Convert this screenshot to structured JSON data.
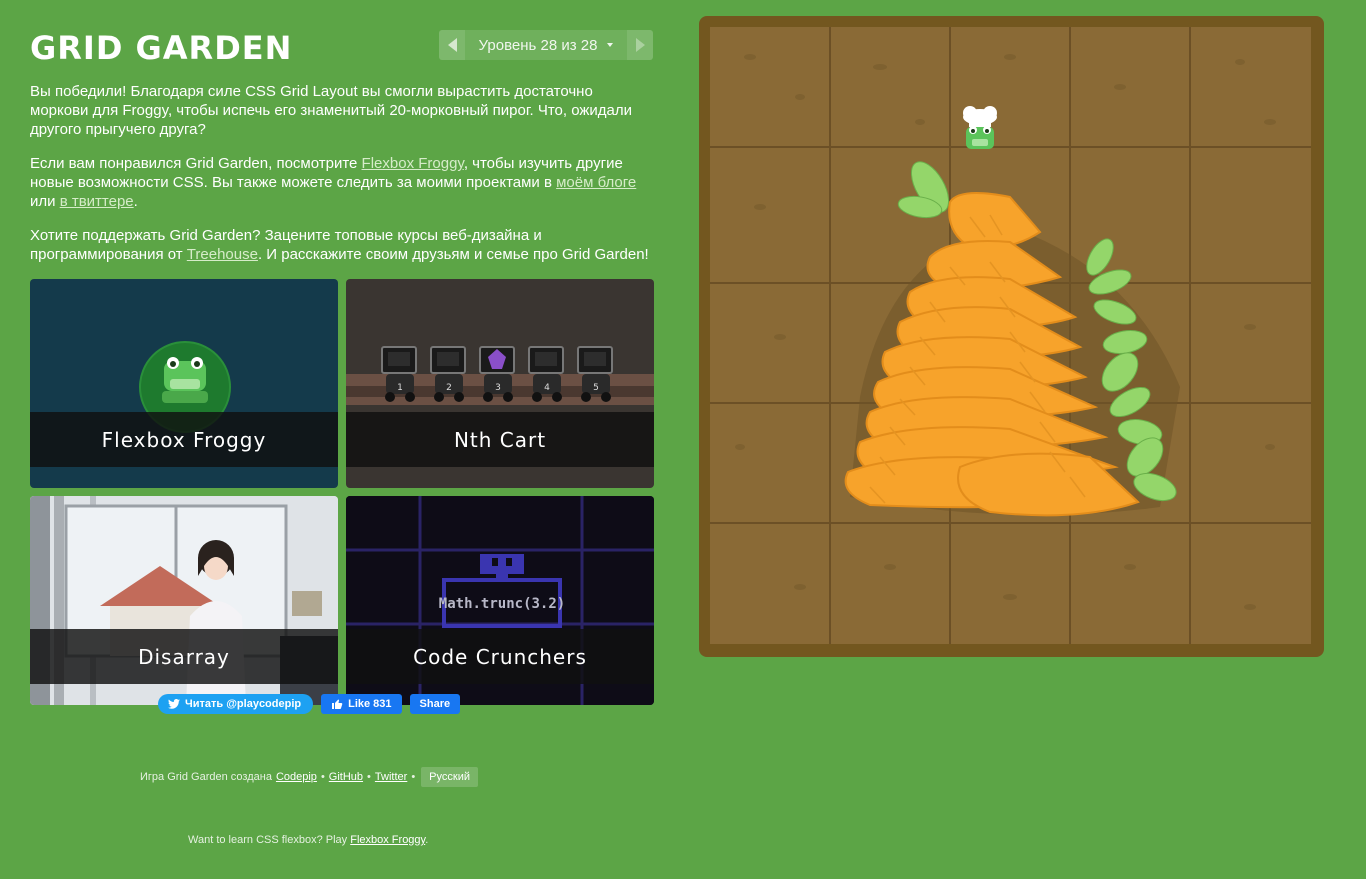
{
  "app": {
    "title": "GRID GARDEN"
  },
  "level_nav": {
    "current_label": "Уровень 28 из 28",
    "prev_icon": "triangle-left-icon",
    "next_icon": "triangle-right-icon"
  },
  "instructions": {
    "paragraph1": "Вы победили! Благодаря силе CSS Grid Layout вы смогли вырастить достаточно моркови для Froggy, чтобы испечь его знаменитый 20-морковный пирог. Что, ожидали другого прыгучего друга?",
    "p2_before": "Если вам понравился Grid Garden, посмотрите ",
    "p2_link_froggy": "Flexbox Froggy",
    "p2_middle": ", чтобы изучить другие новые возможности CSS. Вы также можете следить за моими проектами в ",
    "p2_link_blog": "моём блоге",
    "p2_or": " или ",
    "p2_link_twitter": "в твиттере",
    "p2_end": ".",
    "p3_before": "Хотите поддержать Grid Garden? Зацените топовые курсы веб-дизайна и программирования от ",
    "p3_link_treehouse": "Treehouse",
    "p3_after": ". И расскажите своим друзьям и семье про Grid Garden!"
  },
  "games": {
    "froggy": "Flexbox Froggy",
    "nthcart": "Nth Cart",
    "disarray": "Disarray",
    "crunchers": "Code Crunchers",
    "crunchers_code": "Math.trunc(3.2)",
    "cart_numbers": [
      "1",
      "2",
      "3",
      "4",
      "5"
    ]
  },
  "social": {
    "twitter_label": "Читать @playcodepip",
    "like_label": "Like 831",
    "share_label": "Share"
  },
  "footer": {
    "credits_prefix": "Игра Grid Garden создана",
    "codepip": "Codepip",
    "github": "GitHub",
    "twitter": "Twitter",
    "bullet": "•",
    "language": "Русский",
    "flexbox_prefix": "Want to learn CSS flexbox? Play",
    "flexbox_link": "Flexbox Froggy",
    "flexbox_suffix": "."
  },
  "colors": {
    "background": "#5ca546",
    "garden_border": "#73571f",
    "soil": "#8a6a36",
    "carrot": "#f7a32b",
    "leaf": "#94d66a",
    "twitter": "#1da1f2",
    "facebook": "#1877f2"
  }
}
